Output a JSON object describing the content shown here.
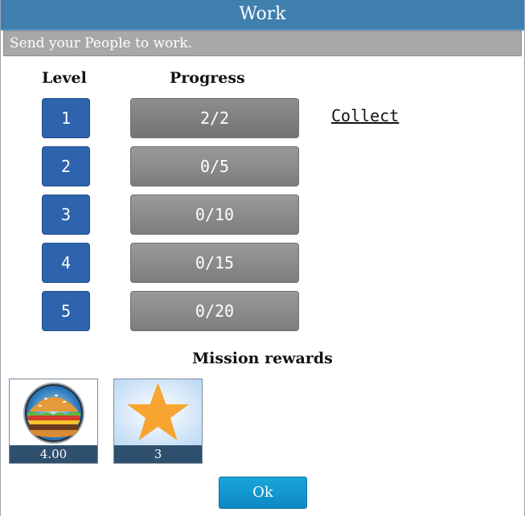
{
  "dialog": {
    "title": "Work",
    "subtitle": "Send your People to work."
  },
  "table": {
    "level_header": "Level",
    "progress_header": "Progress",
    "rows": [
      {
        "level": "1",
        "progress": "2/2",
        "done": 2,
        "total": 2,
        "action": "Collect"
      },
      {
        "level": "2",
        "progress": "0/5",
        "done": 0,
        "total": 5
      },
      {
        "level": "3",
        "progress": "0/10",
        "done": 0,
        "total": 10
      },
      {
        "level": "4",
        "progress": "0/15",
        "done": 0,
        "total": 15
      },
      {
        "level": "5",
        "progress": "0/20",
        "done": 0,
        "total": 20
      }
    ]
  },
  "rewards": {
    "title": "Mission rewards",
    "items": [
      {
        "icon": "burger-icon",
        "value": "4.00"
      },
      {
        "icon": "star-icon",
        "value": "3"
      }
    ]
  },
  "ok_label": "Ok",
  "colors": {
    "title_bar": "#3f7fae",
    "level_badge": "#2e63ad",
    "progress_bar": "#8a8a8a",
    "reward_label": "#2f4f6e",
    "ok_button": "#1499d0",
    "star": "#f7a530"
  }
}
